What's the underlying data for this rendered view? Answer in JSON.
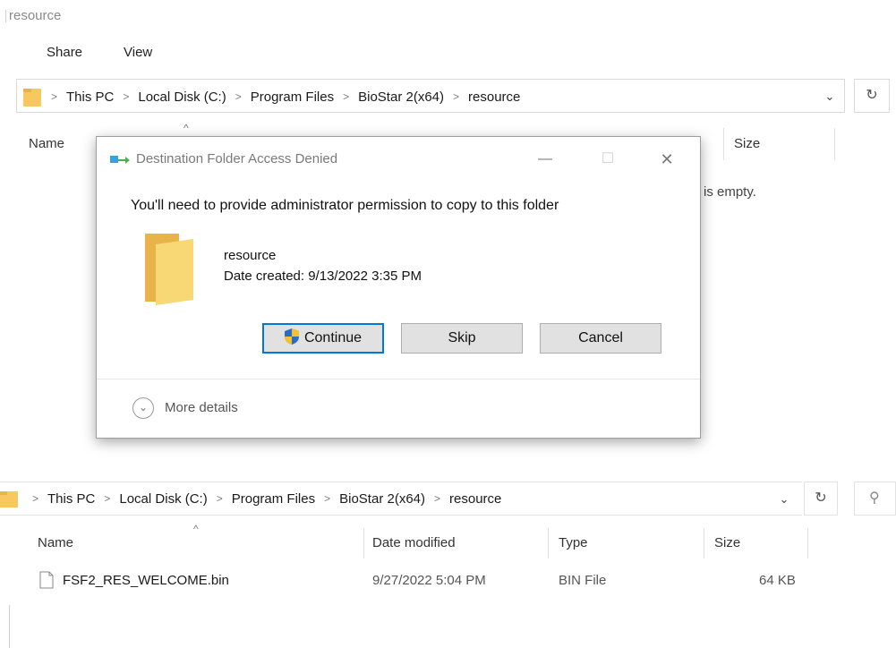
{
  "top_window": {
    "title": "resource",
    "ribbon_tabs": [
      "Share",
      "View"
    ],
    "breadcrumb": [
      "This PC",
      "Local Disk (C:)",
      "Program Files",
      "BioStar 2(x64)",
      "resource"
    ],
    "columns": {
      "name": "Name",
      "size": "Size"
    },
    "empty_message": "is empty."
  },
  "dialog": {
    "title": "Destination Folder Access Denied",
    "message": "You'll need to provide administrator permission to copy to this folder",
    "item_name": "resource",
    "item_date": "Date created: 9/13/2022 3:35 PM",
    "buttons": {
      "continue": "Continue",
      "skip": "Skip",
      "cancel": "Cancel"
    },
    "more_details": "More details",
    "window_controls": {
      "minimize": "—",
      "maximize": "☐",
      "close": "✕"
    }
  },
  "bottom_window": {
    "breadcrumb": [
      "This PC",
      "Local Disk (C:)",
      "Program Files",
      "BioStar 2(x64)",
      "resource"
    ],
    "columns": {
      "name": "Name",
      "date": "Date modified",
      "type": "Type",
      "size": "Size"
    },
    "files": [
      {
        "name": "FSF2_RES_WELCOME.bin",
        "date": "9/27/2022 5:04 PM",
        "type": "BIN File",
        "size": "64 KB"
      }
    ]
  },
  "colors": {
    "accent": "#0078d7",
    "folder": "#f6c85f"
  },
  "icons": [
    "folder-icon",
    "chevron-right-icon",
    "chevron-down-icon",
    "refresh-icon",
    "search-icon",
    "shield-icon",
    "file-icon",
    "sort-up-icon"
  ]
}
